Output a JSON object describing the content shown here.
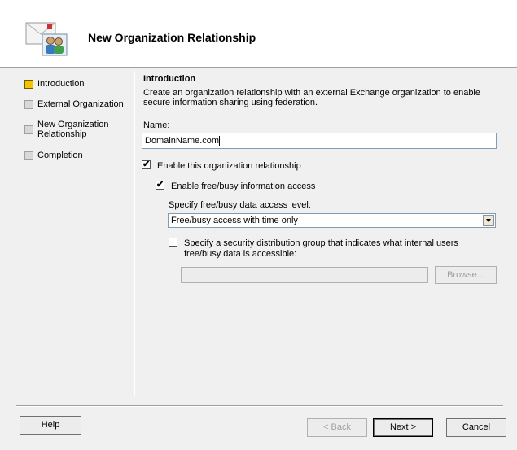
{
  "header": {
    "title": "New Organization Relationship",
    "icon": "wizard-organization-icon"
  },
  "steps": [
    {
      "label": "Introduction",
      "active": true
    },
    {
      "label": "External Organization",
      "active": false
    },
    {
      "label": "New Organization",
      "label2": "Relationship",
      "active": false
    },
    {
      "label": "Completion",
      "active": false
    }
  ],
  "main": {
    "section_title": "Introduction",
    "description": "Create an organization relationship with an external Exchange organization to enable secure information sharing using federation.",
    "name_label": "Name:",
    "name_value": "DomainName.com",
    "enable_relationship": {
      "label": "Enable this organization relationship",
      "checked": true
    },
    "enable_freebusy": {
      "label": "Enable free/busy information access",
      "checked": true
    },
    "access_level_label": "Specify free/busy data access level:",
    "access_level_value": "Free/busy access with time only",
    "security_group": {
      "label": "Specify a security distribution group that indicates what internal users free/busy data is accessible:",
      "checked": false
    },
    "group_field_value": "",
    "browse_label": "Browse..."
  },
  "footer": {
    "help_label": "Help",
    "back_label": "< Back",
    "next_label": "Next >",
    "cancel_label": "Cancel"
  }
}
